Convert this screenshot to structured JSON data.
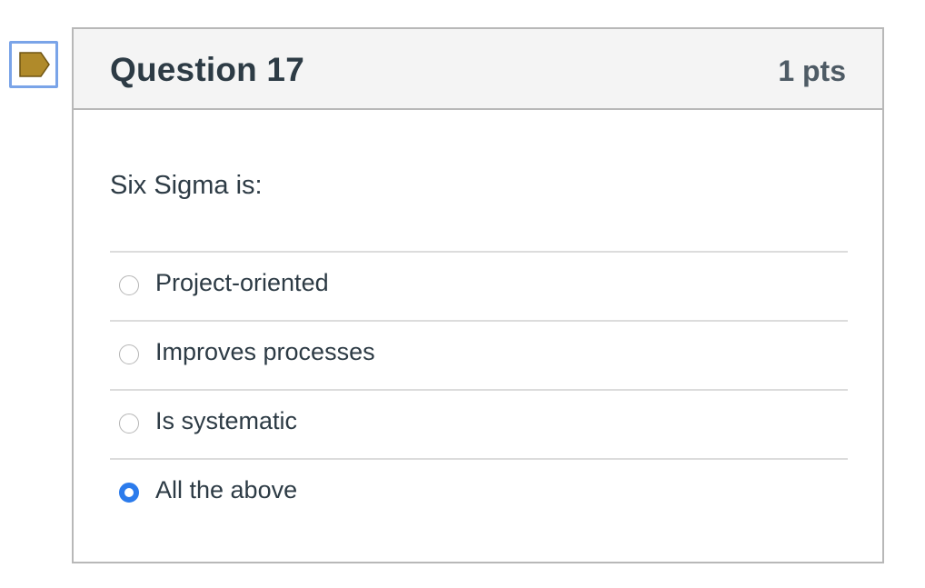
{
  "flag": {
    "icon": "bookmark-flag-icon",
    "color": "#b08a2a"
  },
  "question": {
    "title": "Question 17",
    "points": "1 pts",
    "text": "Six Sigma is:"
  },
  "answers": [
    {
      "label": "Project-oriented",
      "selected": false
    },
    {
      "label": "Improves processes",
      "selected": false
    },
    {
      "label": "Is systematic",
      "selected": false
    },
    {
      "label": "All the above",
      "selected": true
    }
  ],
  "colors": {
    "accent": "#2b7bec",
    "text": "#2d3b45"
  }
}
